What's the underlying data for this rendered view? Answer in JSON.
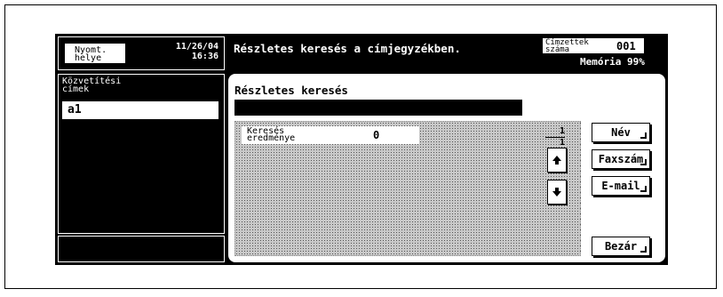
{
  "header": {
    "location_button": "Nyomt.\nhelye",
    "date": "11/26/04",
    "time": "16:36",
    "message": "Részletes keresés a címjegyzékben.",
    "recipients_label": "Címzettek\nszáma",
    "recipients_count": "001",
    "memory": "Memória 99%"
  },
  "left_panel": {
    "title": "Közvetítési\ncímek",
    "selected_item": "a1"
  },
  "main": {
    "title": "Részletes keresés",
    "search_value": "",
    "result_label": "Keresés\neredménye",
    "result_count": "0",
    "page_current": "1",
    "page_total": "1"
  },
  "buttons": {
    "name": "Név",
    "fax": "Faxszám",
    "email": "E-mail",
    "close": "Bezár"
  }
}
